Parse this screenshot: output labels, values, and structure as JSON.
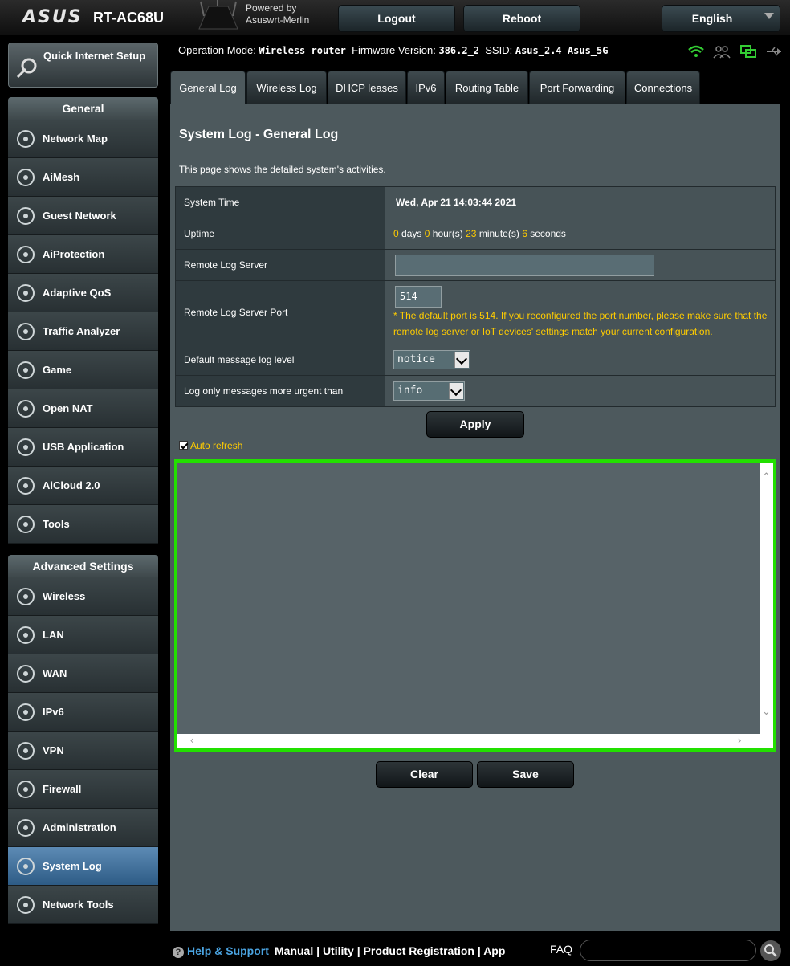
{
  "header": {
    "brand": "ASUS",
    "model": "RT-AC68U",
    "powered_by_line1": "Powered by",
    "powered_by_line2": "Asuswrt-Merlin",
    "logout": "Logout",
    "reboot": "Reboot",
    "language": "English"
  },
  "sidebar": {
    "qis_label": "Quick Internet Setup",
    "general_head": "General",
    "general_items": [
      {
        "label": "Network Map",
        "icon": "globe-icon"
      },
      {
        "label": "AiMesh",
        "icon": "mesh-icon"
      },
      {
        "label": "Guest Network",
        "icon": "guest-globe-icon"
      },
      {
        "label": "AiProtection",
        "icon": "shield-lock-icon"
      },
      {
        "label": "Adaptive QoS",
        "icon": "gauge-icon"
      },
      {
        "label": "Traffic Analyzer",
        "icon": "pulse-icon"
      },
      {
        "label": "Game",
        "icon": "gamepad-icon"
      },
      {
        "label": "Open NAT",
        "icon": "open-nat-icon"
      },
      {
        "label": "USB Application",
        "icon": "usb-icon"
      },
      {
        "label": "AiCloud 2.0",
        "icon": "cloud-icon"
      },
      {
        "label": "Tools",
        "icon": "wrench-icon"
      }
    ],
    "advanced_head": "Advanced Settings",
    "advanced_items": [
      {
        "label": "Wireless",
        "icon": "wifi-icon"
      },
      {
        "label": "LAN",
        "icon": "lan-icon"
      },
      {
        "label": "WAN",
        "icon": "wan-globe-icon"
      },
      {
        "label": "IPv6",
        "icon": "ipv6-icon"
      },
      {
        "label": "VPN",
        "icon": "vpn-icon"
      },
      {
        "label": "Firewall",
        "icon": "firewall-icon"
      },
      {
        "label": "Administration",
        "icon": "admin-gear-icon"
      },
      {
        "label": "System Log",
        "icon": "log-icon"
      },
      {
        "label": "Network Tools",
        "icon": "network-tools-icon"
      }
    ],
    "active_item": "System Log"
  },
  "status": {
    "op_mode_label": "Operation Mode:",
    "op_mode_value": "Wireless router",
    "fw_label": "Firmware Version:",
    "fw_value": "386.2_2",
    "ssid_label": "SSID:",
    "ssid_1": "Asus_2.4",
    "ssid_2": "Asus_5G",
    "icons": [
      "wifi-status-icon",
      "clients-icon",
      "network-status-icon",
      "usb-status-icon"
    ],
    "wifi_color": "#33cc33"
  },
  "tabs": [
    "General Log",
    "Wireless Log",
    "DHCP leases",
    "IPv6",
    "Routing Table",
    "Port Forwarding",
    "Connections"
  ],
  "active_tab": "General Log",
  "main": {
    "title": "System Log - General Log",
    "description": "This page shows the detailed system's activities.",
    "system_time_label": "System Time",
    "system_time_value": "Wed, Apr 21 14:03:44 2021",
    "uptime_label": "Uptime",
    "uptime_days": "0",
    "uptime_days_unit": "days",
    "uptime_hours": "0",
    "uptime_hours_unit": "hour(s)",
    "uptime_minutes": "23",
    "uptime_minutes_unit": "minute(s)",
    "uptime_seconds": "6",
    "uptime_seconds_unit": "seconds",
    "remote_server_label": "Remote Log Server",
    "remote_server_value": "",
    "remote_port_label": "Remote Log Server Port",
    "remote_port_value": "514",
    "remote_port_note": "* The default port is 514. If you reconfigured the port number, please make sure that the remote log server or IoT devices' settings match your current configuration.",
    "default_level_label": "Default message log level",
    "default_level_value": "notice",
    "urgent_label": "Log only messages more urgent than",
    "urgent_value": "info",
    "apply": "Apply",
    "auto_refresh": "Auto refresh",
    "auto_refresh_checked": true,
    "log_content": "",
    "clear": "Clear",
    "save": "Save",
    "accent_color": "#ffcc00",
    "log_border_color": "#22e000"
  },
  "footer": {
    "help": "Help & Support",
    "manual": "Manual",
    "utility": "Utility",
    "registration": "Product Registration",
    "app": "App",
    "faq": "FAQ"
  }
}
